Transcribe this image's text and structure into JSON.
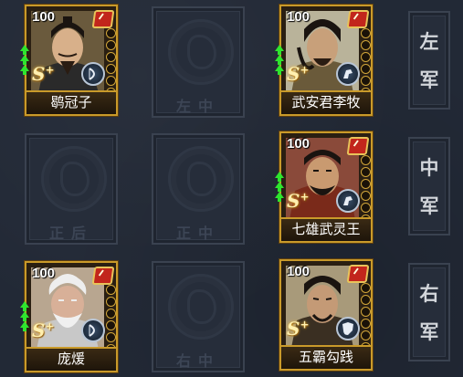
{
  "formation": {
    "rows": [
      {
        "army_label": [
          "左",
          "军"
        ],
        "slots": [
          {
            "type": "general",
            "name": "鹖冠子",
            "level": "100",
            "grade": "S",
            "grade_mark": "+",
            "unit_icon": "bow-icon"
          },
          {
            "type": "empty",
            "label": "左中"
          },
          {
            "type": "general",
            "name": "武安君李牧",
            "level": "100",
            "grade": "S",
            "grade_mark": "+",
            "unit_icon": "cavalry-icon"
          }
        ]
      },
      {
        "army_label": [
          "中",
          "军"
        ],
        "slots": [
          {
            "type": "empty",
            "label": "正后"
          },
          {
            "type": "empty",
            "label": "正中"
          },
          {
            "type": "general",
            "name": "七雄武灵王",
            "level": "100",
            "grade": "S",
            "grade_mark": "+",
            "unit_icon": "cavalry-icon"
          }
        ]
      },
      {
        "army_label": [
          "右",
          "军"
        ],
        "slots": [
          {
            "type": "general",
            "name": "庞煖",
            "level": "100",
            "grade": "S",
            "grade_mark": "+",
            "unit_icon": "bow-icon"
          },
          {
            "type": "empty",
            "label": "右中"
          },
          {
            "type": "general",
            "name": "五霸勾践",
            "level": "100",
            "grade": "S",
            "grade_mark": "+",
            "unit_icon": "shield-icon"
          }
        ]
      }
    ]
  },
  "colors": {
    "background": "#222936",
    "card_border": "#c99a2a",
    "upgrade_arrow": "#2ee52e",
    "badge_red": "#c2261c"
  }
}
